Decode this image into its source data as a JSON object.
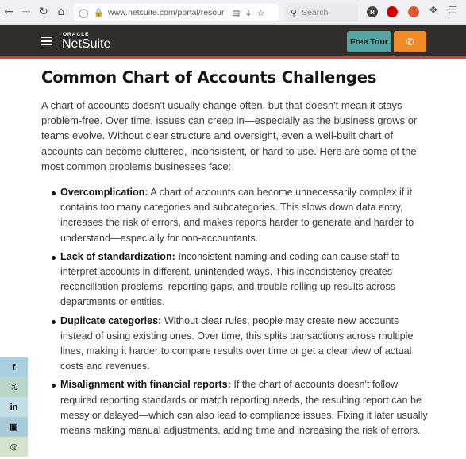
{
  "browser": {
    "url": "www.netsuite.com/portal/resource/",
    "search_placeholder": "Search",
    "extensions": [
      "R",
      "uBlock",
      "D"
    ]
  },
  "header": {
    "brand_top": "ORACLE",
    "brand_main": "NetSuite",
    "cta_label": "Free Tour",
    "accent_color": "#c74634",
    "cta_color": "#55a3a1",
    "phone_color": "#f08a24"
  },
  "article": {
    "heading": "Common Chart of Accounts Challenges",
    "intro": "A chart of accounts doesn't usually change often, but that doesn't mean it stays problem-free. Over time, issues can creep in—especially as the business grows or teams evolve. Without clear structure and oversight, even a well-built chart of accounts can become cluttered, inconsistent, or hard to use. Here are some of the most common problems businesses face:",
    "items": [
      {
        "term": "Overcomplication:",
        "text": " A chart of accounts can become unnecessarily complex if it contains too many categories and subcategories. This slows down data entry, increases the risk of errors, and makes reports harder to generate and harder to understand—especially for non-accountants."
      },
      {
        "term": "Lack of standardization:",
        "text": " Inconsistent naming and coding can cause staff to interpret accounts in different, unintended ways. This inconsistency creates reconciliation problems, reporting gaps, and trouble rolling up results across departments or entities."
      },
      {
        "term": "Duplicate categories:",
        "text": " Without clear rules, people may create new accounts instead of using existing ones. Over time, this splits transactions across multiple lines, making it harder to compare results over time or get a clear view of actual costs and revenues."
      },
      {
        "term": "Misalignment with financial reports:",
        "text": " If the chart of accounts doesn't follow required reporting standards or match reporting needs, the resulting report can be messy or delayed—which can also lead to compliance issues. Fixing it later usually means making manual adjustments, adding time and increasing the risk of errors."
      }
    ]
  },
  "social": [
    "facebook",
    "x",
    "linkedin",
    "flipboard",
    "instagram"
  ]
}
